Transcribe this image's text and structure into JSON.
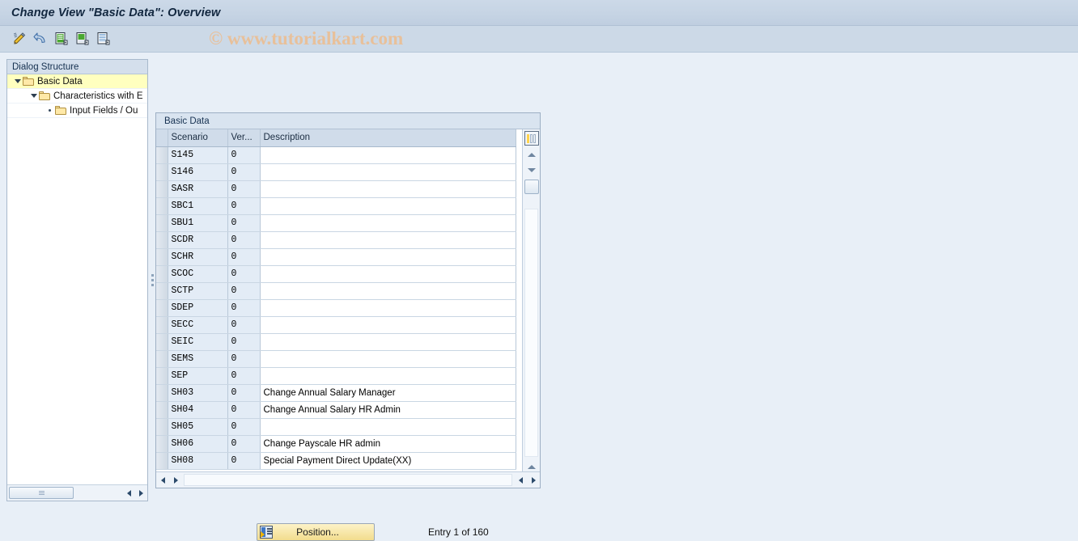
{
  "window": {
    "title": "Change View \"Basic Data\": Overview",
    "watermark": "© www.tutorialkart.com"
  },
  "toolbar": {
    "buttons": [
      {
        "name": "change-entry",
        "icon": "pencil-icon",
        "label": "Change Entry"
      },
      {
        "name": "undo",
        "icon": "undo-arrow-icon",
        "label": "Undo"
      },
      {
        "name": "new-entries",
        "icon": "new-entries-icon",
        "label": "New Entries"
      },
      {
        "name": "copy-as",
        "icon": "copy-as-icon",
        "label": "Copy As..."
      },
      {
        "name": "details",
        "icon": "details-icon",
        "label": "Details"
      }
    ]
  },
  "sidebar": {
    "header": "Dialog Structure",
    "items": [
      {
        "label": "Basic Data",
        "level": 0,
        "expanded": true,
        "selected": true,
        "icon": "folder-open-icon"
      },
      {
        "label": "Characteristics with E",
        "level": 1,
        "expanded": true,
        "selected": false,
        "icon": "folder-icon"
      },
      {
        "label": "Input Fields / Ou",
        "level": 2,
        "expanded": false,
        "selected": false,
        "icon": "folder-icon"
      }
    ]
  },
  "table": {
    "panel_title": "Basic Data",
    "columns": [
      "Scenario",
      "Ver...",
      "Description"
    ],
    "rows": [
      {
        "scenario": "S145",
        "version": "0",
        "description": ""
      },
      {
        "scenario": "S146",
        "version": "0",
        "description": ""
      },
      {
        "scenario": "SASR",
        "version": "0",
        "description": ""
      },
      {
        "scenario": "SBC1",
        "version": "0",
        "description": ""
      },
      {
        "scenario": "SBU1",
        "version": "0",
        "description": ""
      },
      {
        "scenario": "SCDR",
        "version": "0",
        "description": ""
      },
      {
        "scenario": "SCHR",
        "version": "0",
        "description": ""
      },
      {
        "scenario": "SCOC",
        "version": "0",
        "description": ""
      },
      {
        "scenario": "SCTP",
        "version": "0",
        "description": ""
      },
      {
        "scenario": "SDEP",
        "version": "0",
        "description": ""
      },
      {
        "scenario": "SECC",
        "version": "0",
        "description": ""
      },
      {
        "scenario": "SEIC",
        "version": "0",
        "description": ""
      },
      {
        "scenario": "SEMS",
        "version": "0",
        "description": ""
      },
      {
        "scenario": "SEP",
        "version": "0",
        "description": ""
      },
      {
        "scenario": "SH03",
        "version": "0",
        "description": "Change Annual Salary Manager"
      },
      {
        "scenario": "SH04",
        "version": "0",
        "description": "Change Annual Salary HR Admin"
      },
      {
        "scenario": "SH05",
        "version": "0",
        "description": ""
      },
      {
        "scenario": "SH06",
        "version": "0",
        "description": "Change Payscale HR admin"
      },
      {
        "scenario": "SH08",
        "version": "0",
        "description": "Special Payment Direct Update(XX)"
      }
    ]
  },
  "footer": {
    "position_button": "Position...",
    "entry_status": "Entry 1 of 160"
  },
  "colors": {
    "titlebar": "#c6d4e4",
    "background": "#e8eff7",
    "selected_row": "#ffffbf",
    "grid_header": "#d0dcea",
    "cell_blue": "#e3ecf6",
    "button_yellow": "#f2dc8d",
    "watermark": "#e8c09a"
  }
}
